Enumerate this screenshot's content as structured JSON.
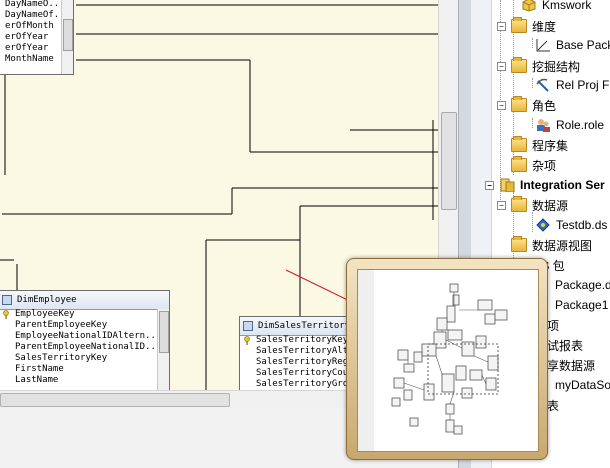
{
  "top_table": {
    "rows": [
      "DayNameO...",
      "DayNameOf...",
      "erOfMonth",
      "erOfYear",
      "erOfYear",
      "MonthName"
    ]
  },
  "dim_employee": {
    "title": "DimEmployee",
    "rows": [
      "EmployeeKey",
      "ParentEmployeeKey",
      "EmployeeNationalIDAltern...",
      "ParentEmployeeNationalID...",
      "SalesTerritoryKey",
      "FirstName",
      "LastName"
    ]
  },
  "dim_sales_territory": {
    "title": "DimSalesTerritory",
    "rows": [
      "SalesTerritoryKey",
      "SalesTerritoryAlte...",
      "SalesTerritoryRegi...",
      "SalesTerritoryCount...",
      "SalesTerritoryGroup..."
    ]
  },
  "solution_tree": {
    "items": [
      {
        "label": "Kmswork",
        "icon": "cube-icon"
      },
      {
        "label": "维度",
        "icon": "folder-icon"
      },
      {
        "label": "Base Pack",
        "icon": "dimension-icon"
      },
      {
        "label": "挖掘结构",
        "icon": "folder-icon"
      },
      {
        "label": "Rel Proj F",
        "icon": "mining-icon"
      },
      {
        "label": "角色",
        "icon": "folder-icon"
      },
      {
        "label": "Role.role",
        "icon": "role-icon"
      },
      {
        "label": "程序集",
        "icon": "folder-icon"
      },
      {
        "label": "杂项",
        "icon": "folder-icon"
      },
      {
        "label": "Integration Ser",
        "icon": "project-icon"
      },
      {
        "label": "数据源",
        "icon": "folder-icon"
      },
      {
        "label": "Testdb.ds",
        "icon": "datasource-icon"
      },
      {
        "label": "数据源视图",
        "icon": "folder-icon"
      },
      {
        "label": "IS 包",
        "icon": "folder-icon"
      },
      {
        "label": "Package.d",
        "icon": "package-icon"
      },
      {
        "label": "Package1",
        "icon": "package-icon"
      },
      {
        "label": "项",
        "icon": "folder-icon"
      },
      {
        "label": "试报表",
        "icon": "folder-icon"
      },
      {
        "label": "享数据源",
        "icon": "folder-icon"
      },
      {
        "label": "myDataSo",
        "icon": "datasource-icon"
      },
      {
        "label": "表",
        "icon": "folder-icon"
      }
    ]
  },
  "colors": {
    "canvas": "#fbf8e3",
    "arrow": "#d9141b",
    "popup_frame": "#c8a86e"
  }
}
